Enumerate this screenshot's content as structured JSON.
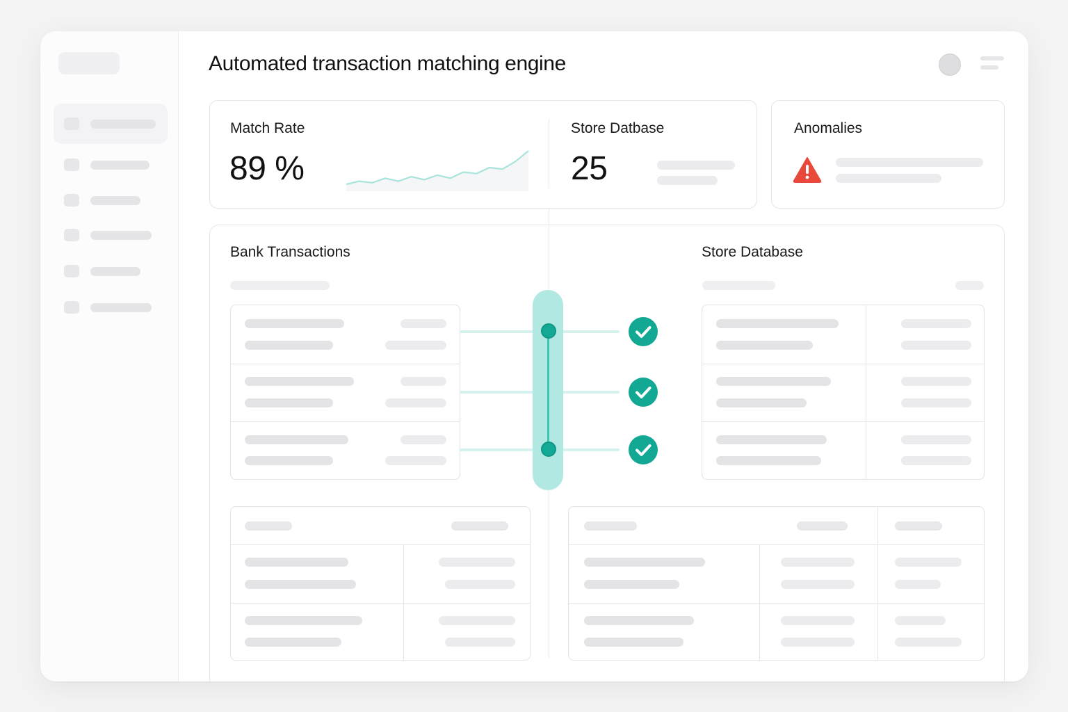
{
  "header": {
    "title": "Automated transaction matching engine",
    "avatar_icon": "user-avatar",
    "menu_icon": "menu-icon"
  },
  "sidebar": {
    "items": [
      {
        "icon": "nav-icon",
        "active": true
      },
      {
        "icon": "nav-icon",
        "active": false
      },
      {
        "icon": "nav-icon",
        "active": false
      },
      {
        "icon": "nav-icon",
        "active": false
      },
      {
        "icon": "nav-icon",
        "active": false
      },
      {
        "icon": "nav-icon",
        "active": false
      }
    ]
  },
  "metrics": {
    "match_rate": {
      "label": "Match Rate",
      "value": "89 %",
      "trend_values": [
        3,
        5,
        4,
        7,
        5,
        8,
        6,
        9,
        7,
        11,
        10,
        14,
        13,
        18,
        25
      ],
      "trend_color": "#a8e4dc"
    },
    "store": {
      "label": "Store Datbase",
      "value": "25"
    },
    "anomalies": {
      "label": "Anomalies",
      "icon": "warning-icon",
      "icon_color": "#e8493b"
    }
  },
  "matching": {
    "bank_title": "Bank Transactions",
    "store_title": "Store Database",
    "accent_color": "#12a893",
    "matched_rows": 3,
    "check_icon": "check-circle-icon"
  }
}
